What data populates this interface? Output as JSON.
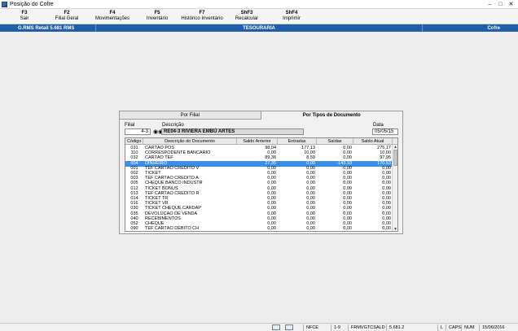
{
  "window": {
    "title": "Posição do Cofre"
  },
  "toolbar": {
    "keys": [
      {
        "key": "F3",
        "label": "Sair"
      },
      {
        "key": "F2",
        "label": "Filial Geral"
      },
      {
        "key": "F4",
        "label": "Movimentações"
      },
      {
        "key": "F5",
        "label": "Inventário"
      },
      {
        "key": "F7",
        "label": "Histórico Inventário"
      },
      {
        "key": "ShF3",
        "label": "Recalcular"
      },
      {
        "key": "ShF4",
        "label": "Imprimir"
      }
    ]
  },
  "header": {
    "left": "G.RMS Retail 5.681 RMS",
    "center": "TESOURARIA",
    "right": "Cofre"
  },
  "tabs": [
    {
      "label": "Por Filial",
      "active": false
    },
    {
      "label": "Por Tipos de Documento",
      "active": true
    }
  ],
  "form": {
    "filial_label": "Filial",
    "filial_value": "4-3",
    "descricao_label": "Descrição",
    "descricao_value": "RE04-3 RIVIERA EMBÚ ARTES",
    "data_label": "Data",
    "data_value": "05/05/15"
  },
  "grid": {
    "columns": [
      "Código",
      "Descrição do Documento",
      "Saldo Anterior",
      "Entradas",
      "Saídas",
      "Saldo Atual"
    ],
    "rows": [
      {
        "cod": "031",
        "desc": "CARTÃO POS",
        "ant": "98,04",
        "ent": "177,13",
        "sai": "0,00",
        "atu": "275,17",
        "selected": false
      },
      {
        "cod": "110",
        "desc": "CORRESPODENTE BANCARIO",
        "ant": "0,00",
        "ent": "10,00",
        "sai": "0,00",
        "atu": "10,00",
        "selected": false
      },
      {
        "cod": "032",
        "desc": "CARTÃO TEF",
        "ant": "89,36",
        "ent": "8,59",
        "sai": "0,00",
        "atu": "97,95",
        "selected": false
      },
      {
        "cod": "004",
        "desc": "DINHEIRO",
        "ant": "27,35",
        "ent": "0,00",
        "sai": "-143,18",
        "atu": "170,53",
        "selected": true
      },
      {
        "cod": "001",
        "desc": "TEF CARTÃO CRÉDITO V",
        "ant": "0,00",
        "ent": "0,00",
        "sai": "0,00",
        "atu": "0,00",
        "selected": false
      },
      {
        "cod": "002",
        "desc": "TICKET",
        "ant": "0,00",
        "ent": "0,00",
        "sai": "0,00",
        "atu": "0,00",
        "selected": false
      },
      {
        "cod": "003",
        "desc": "TEF CARTÃO CRÉDITO A",
        "ant": "0,00",
        "ent": "0,00",
        "sai": "0,00",
        "atu": "0,00",
        "selected": false
      },
      {
        "cod": "005",
        "desc": "CHEQUE BANCO INDUSTR",
        "ant": "0,00",
        "ent": "0,00",
        "sai": "0,00",
        "atu": "0,00",
        "selected": false
      },
      {
        "cod": "012",
        "desc": "TICKET BONUS",
        "ant": "0,00",
        "ent": "0,00",
        "sai": "0,00",
        "atu": "0,00",
        "selected": false
      },
      {
        "cod": "013",
        "desc": "TEF CARTÃO CRÉDITO R",
        "ant": "0,00",
        "ent": "0,00",
        "sai": "0,00",
        "atu": "0,00",
        "selected": false
      },
      {
        "cod": "014",
        "desc": "TICKET TR",
        "ant": "0,00",
        "ent": "0,00",
        "sai": "0,00",
        "atu": "0,00",
        "selected": false
      },
      {
        "cod": "016",
        "desc": "TICKET VR",
        "ant": "0,00",
        "ent": "0,00",
        "sai": "0,00",
        "atu": "0,00",
        "selected": false
      },
      {
        "cod": "030",
        "desc": "TICKET CHEQUE CARDÁP",
        "ant": "0,00",
        "ent": "0,00",
        "sai": "0,00",
        "atu": "0,00",
        "selected": false
      },
      {
        "cod": "035",
        "desc": "DEVOLUÇÃO DE VENDA",
        "ant": "0,00",
        "ent": "0,00",
        "sai": "0,00",
        "atu": "0,00",
        "selected": false
      },
      {
        "cod": "040",
        "desc": "RECEBIMENTOS",
        "ant": "0,00",
        "ent": "0,00",
        "sai": "0,00",
        "atu": "0,00",
        "selected": false
      },
      {
        "cod": "052",
        "desc": "CHEQUE",
        "ant": "0,00",
        "ent": "0,00",
        "sai": "0,00",
        "atu": "0,00",
        "selected": false
      },
      {
        "cod": "090",
        "desc": "TEF CARTÃO DÉBITO CH",
        "ant": "0,00",
        "ent": "0,00",
        "sai": "0,00",
        "atu": "0,00",
        "selected": false
      }
    ]
  },
  "statusbar": {
    "segments": [
      "NFCE",
      "1-9",
      "FRMVGTCSALD",
      "5.681.2",
      "L",
      "CAPS",
      "NUM",
      "15/06/2016"
    ]
  },
  "colors": {
    "header_blue": "#1f5ea8",
    "selection_blue": "#3a8ee6"
  }
}
